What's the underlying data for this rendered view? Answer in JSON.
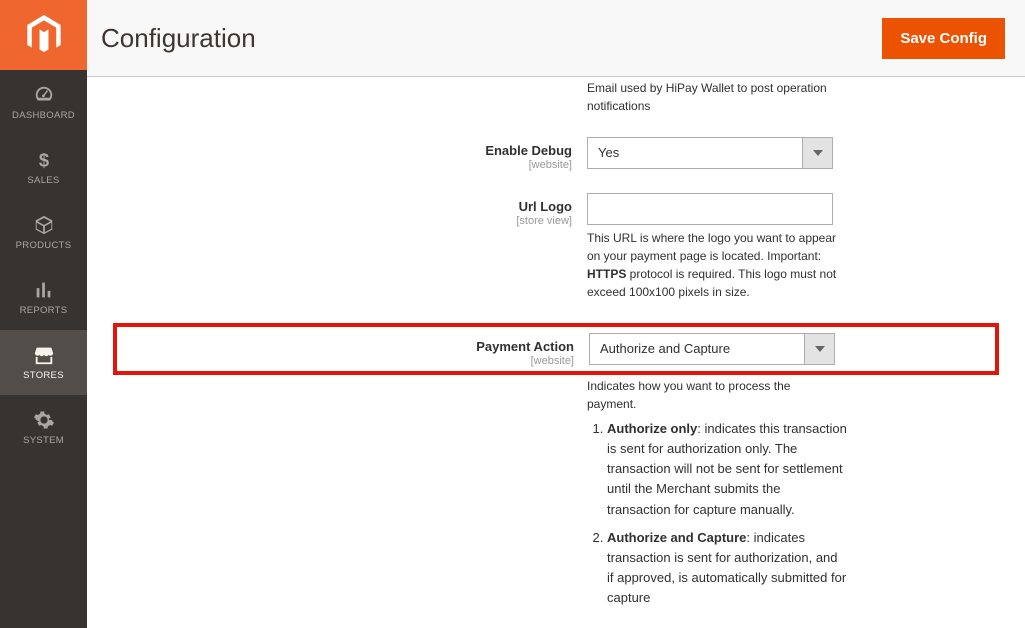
{
  "sidebar": {
    "items": [
      {
        "label": "DASHBOARD"
      },
      {
        "label": "SALES"
      },
      {
        "label": "PRODUCTS"
      },
      {
        "label": "REPORTS"
      },
      {
        "label": "STORES"
      },
      {
        "label": "SYSTEM"
      }
    ]
  },
  "header": {
    "title": "Configuration",
    "save_label": "Save Config"
  },
  "top_helper": "Email used by HiPay Wallet to post operation notifications",
  "enable_debug": {
    "label": "Enable Debug",
    "scope": "[website]",
    "value": "Yes"
  },
  "url_logo": {
    "label": "Url Logo",
    "scope": "[store view]",
    "value": "",
    "helper_pre": "This URL is where the logo you want to appear on your payment page is located. Important: ",
    "helper_strong": "HTTPS",
    "helper_post": " protocol is required. This logo must not exceed 100x100 pixels in size."
  },
  "payment_action": {
    "label": "Payment Action",
    "scope": "[website]",
    "value": "Authorize and Capture",
    "helper": "Indicates how you want to process the payment.",
    "options": [
      {
        "strong": "Authorize only",
        "text": ": indicates this transaction is sent for authorization only. The transaction will not be sent for settlement until the Merchant submits the transaction for capture manually."
      },
      {
        "strong": "Authorize and Capture",
        "text": ": indicates transaction is sent for authorization, and if approved, is automatically submitted for capture"
      }
    ]
  }
}
